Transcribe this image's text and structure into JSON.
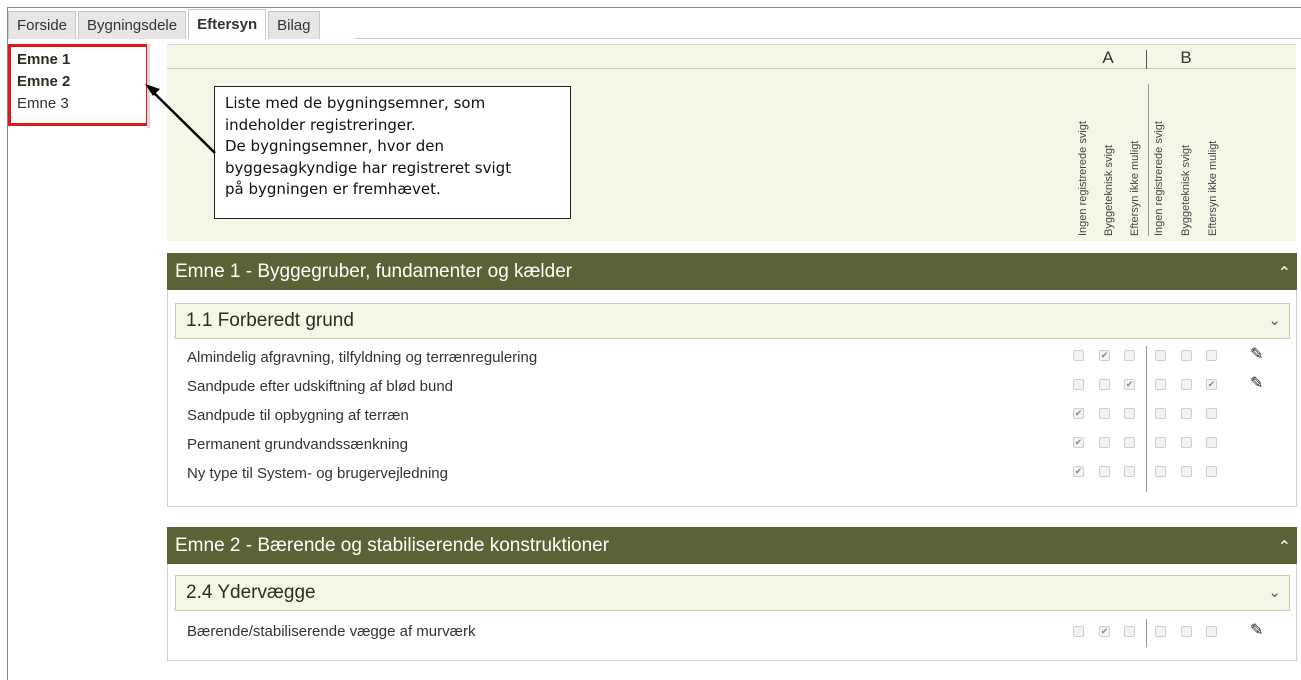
{
  "tabs": [
    {
      "label": "Forside",
      "active": false
    },
    {
      "label": "Bygningsdele",
      "active": false
    },
    {
      "label": "Eftersyn",
      "active": true
    },
    {
      "label": "Bilag",
      "active": false
    }
  ],
  "nav": {
    "items": [
      {
        "label": "Emne 1",
        "bold": true
      },
      {
        "label": "Emne 2",
        "bold": true
      },
      {
        "label": "Emne 3",
        "bold": false
      }
    ]
  },
  "header": {
    "group_a": "A",
    "group_b": "B",
    "columns": [
      "Ingen registrerede svigt",
      "Byggeteknisk svigt",
      "Eftersyn ikke muligt",
      "Ingen registrerede svigt",
      "Byggeteknisk svigt",
      "Eftersyn ikke muligt"
    ]
  },
  "callout": {
    "lines": [
      "Liste med de bygningsemner, som",
      "indeholder registreringer.",
      "De bygningsemner, hvor den",
      "byggesagkyndige har registreret svigt",
      "på bygningen er fremhævet."
    ]
  },
  "sections": [
    {
      "title": "Emne 1 - Byggegruber, fundamenter og kælder",
      "subtitle": "1.1 Forberedt grund",
      "rows": [
        {
          "label": "Almindelig afgravning, tilfyldning og terrænregulering",
          "a": [
            false,
            true,
            false
          ],
          "b": [
            false,
            false,
            false
          ],
          "edit": true
        },
        {
          "label": "Sandpude efter udskiftning af blød bund",
          "a": [
            false,
            false,
            true
          ],
          "b": [
            false,
            false,
            true
          ],
          "edit": true
        },
        {
          "label": "Sandpude til opbygning af terræn",
          "a": [
            true,
            false,
            false
          ],
          "b": [
            false,
            false,
            false
          ],
          "edit": false
        },
        {
          "label": "Permanent grundvandssænkning",
          "a": [
            true,
            false,
            false
          ],
          "b": [
            false,
            false,
            false
          ],
          "edit": false
        },
        {
          "label": "Ny type til System- og brugervejledning",
          "a": [
            true,
            false,
            false
          ],
          "b": [
            false,
            false,
            false
          ],
          "edit": false
        }
      ]
    },
    {
      "title": "Emne 2 - Bærende og stabiliserende konstruktioner",
      "subtitle": "2.4 Ydervægge",
      "rows": [
        {
          "label": "Bærende/stabiliserende vægge af murværk",
          "a": [
            false,
            true,
            false
          ],
          "b": [
            false,
            false,
            false
          ],
          "edit": true
        }
      ]
    }
  ],
  "icons": {
    "collapse": "chevron-up-icon",
    "expand": "chevron-down-icon",
    "edit": "edit-icon",
    "check": "checkmark-icon"
  },
  "colors": {
    "section_bar": "#5a6336",
    "header_bg": "#f5f7e6",
    "highlight_border": "#e3161b"
  }
}
